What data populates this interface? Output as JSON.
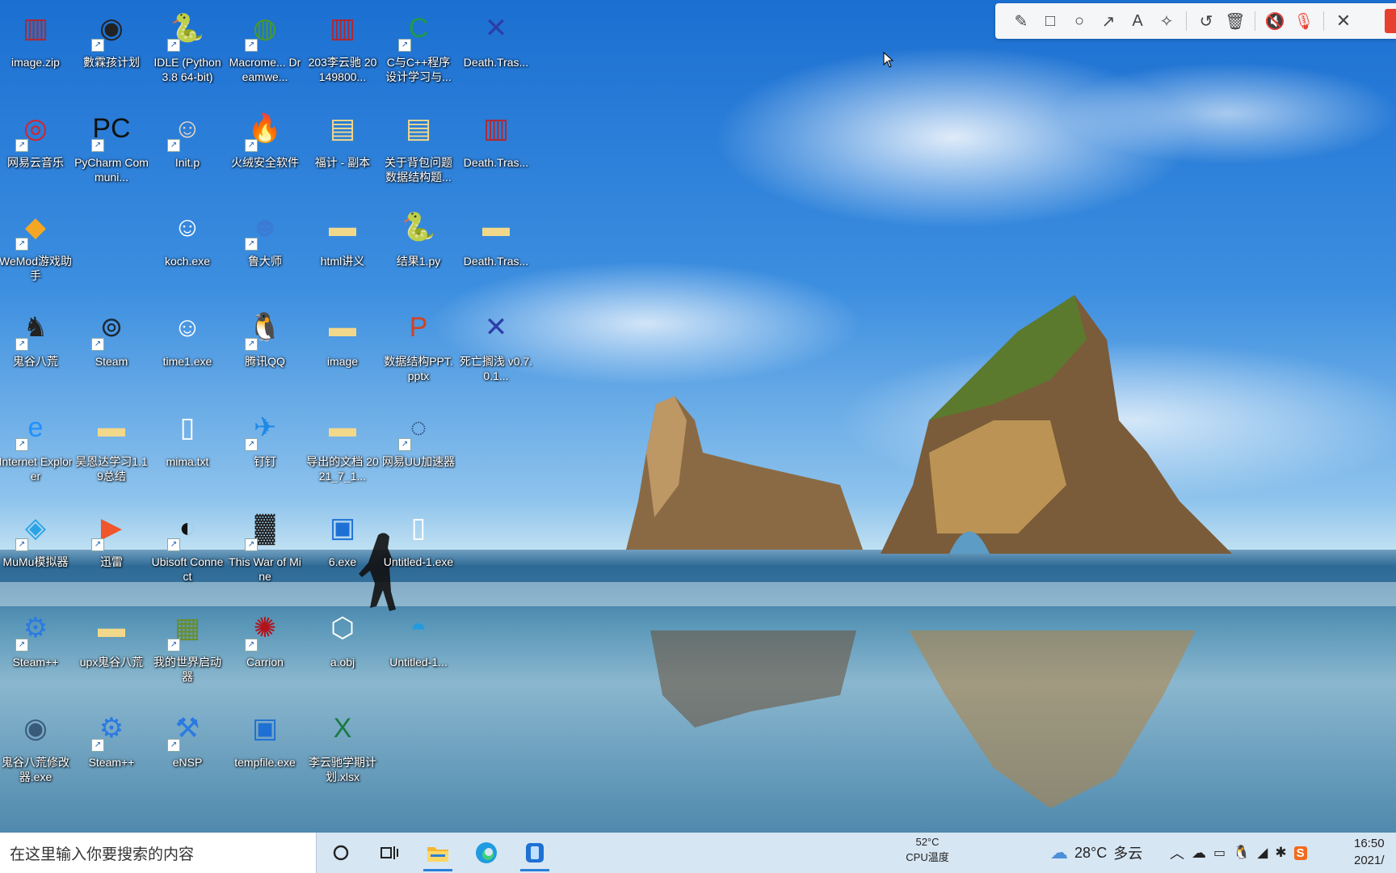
{
  "desktop": {
    "icons": [
      {
        "label": "image.zip",
        "icon": "winrar-archive-icon",
        "glyph": "▥",
        "color": "#b3262d",
        "shortcut": false
      },
      {
        "label": "數霖孩计划",
        "icon": "app-shortcut-icon",
        "glyph": "◉",
        "color": "#222222",
        "shortcut": true
      },
      {
        "label": "IDLE (Python 3.8 64-bit)",
        "icon": "python-idle-icon",
        "glyph": "🐍",
        "color": "#ffffff",
        "shortcut": true
      },
      {
        "label": "Macrome... Dreamwe...",
        "icon": "dreamweaver-icon",
        "glyph": "◍",
        "color": "#4a9a26",
        "shortcut": true
      },
      {
        "label": "203李云驰 20149800...",
        "icon": "winrar-archive-icon",
        "glyph": "▥",
        "color": "#b3262d",
        "shortcut": false
      },
      {
        "label": "C与C++程序设计学习与...",
        "icon": "c-language-icon",
        "glyph": "C",
        "color": "#1f9a4a",
        "shortcut": true
      },
      {
        "label": "Death.Tras...",
        "icon": "game-shortcut-icon",
        "glyph": "✕",
        "color": "#2d3ea8",
        "shortcut": false
      },
      {
        "label": "网易云音乐",
        "icon": "netease-music-icon",
        "glyph": "◎",
        "color": "#d8232a",
        "shortcut": true
      },
      {
        "label": "PyCharm Communi...",
        "icon": "pycharm-icon",
        "glyph": "PC",
        "color": "#111111",
        "shortcut": true
      },
      {
        "label": "Init.p",
        "icon": "anime-app-icon",
        "glyph": "☺",
        "color": "#e8d7c8",
        "shortcut": true
      },
      {
        "label": "火绒安全软件",
        "icon": "huorong-security-icon",
        "glyph": "🔥",
        "color": "#f28c1b",
        "shortcut": true
      },
      {
        "label": "福计 - 副本",
        "icon": "document-icon",
        "glyph": "▤",
        "color": "#f2d88a",
        "shortcut": false
      },
      {
        "label": "关于背包问题数据结构题...",
        "icon": "document-icon",
        "glyph": "▤",
        "color": "#f2d88a",
        "shortcut": false
      },
      {
        "label": "Death.Tras...",
        "icon": "winrar-archive-icon",
        "glyph": "▥",
        "color": "#b3262d",
        "shortcut": false
      },
      {
        "label": "WeMod游戏助手",
        "icon": "wemod-icon",
        "glyph": "◆",
        "color": "#f5a623",
        "shortcut": true
      },
      {
        "label": "",
        "icon": "empty-slot",
        "glyph": "",
        "color": "#000000",
        "shortcut": false
      },
      {
        "label": "koch.exe",
        "icon": "smiley-exe-icon",
        "glyph": "☺",
        "color": "#ffffff",
        "shortcut": false
      },
      {
        "label": "鲁大师",
        "icon": "ludashi-icon",
        "glyph": "☻",
        "color": "#3a7bd5",
        "shortcut": true
      },
      {
        "label": "html讲义",
        "icon": "folder-icon",
        "glyph": "▬",
        "color": "#f2d88a",
        "shortcut": false
      },
      {
        "label": "结果1.py",
        "icon": "python-file-icon",
        "glyph": "🐍",
        "color": "#ffffff",
        "shortcut": false
      },
      {
        "label": "Death.Tras...",
        "icon": "folder-icon",
        "glyph": "▬",
        "color": "#f2d88a",
        "shortcut": false
      },
      {
        "label": "鬼谷八荒",
        "icon": "game-dragon-icon",
        "glyph": "♞",
        "color": "#222222",
        "shortcut": true
      },
      {
        "label": "Steam",
        "icon": "steam-icon",
        "glyph": "⊚",
        "color": "#1b2838",
        "shortcut": true
      },
      {
        "label": "time1.exe",
        "icon": "smiley-exe-icon",
        "glyph": "☺",
        "color": "#ffffff",
        "shortcut": false
      },
      {
        "label": "腾讯QQ",
        "icon": "qq-penguin-icon",
        "glyph": "🐧",
        "color": "#111111",
        "shortcut": true
      },
      {
        "label": "image",
        "icon": "folder-icon",
        "glyph": "▬",
        "color": "#f2d88a",
        "shortcut": false
      },
      {
        "label": "数据结构PPT.pptx",
        "icon": "powerpoint-file-icon",
        "glyph": "P",
        "color": "#d04423",
        "shortcut": false
      },
      {
        "label": "死亡搁浅 v0.7.0.1...",
        "icon": "game-shortcut-icon",
        "glyph": "✕",
        "color": "#2d3ea8",
        "shortcut": false
      },
      {
        "label": "Internet Explorer",
        "icon": "internet-explorer-icon",
        "glyph": "e",
        "color": "#1e90ff",
        "shortcut": true
      },
      {
        "label": "吴恩达学习1.19总结",
        "icon": "folder-icon",
        "glyph": "▬",
        "color": "#f2d88a",
        "shortcut": false
      },
      {
        "label": "mima.txt",
        "icon": "text-file-icon",
        "glyph": "▯",
        "color": "#ffffff",
        "shortcut": false
      },
      {
        "label": "钉钉",
        "icon": "dingtalk-icon",
        "glyph": "✈",
        "color": "#1e88e5",
        "shortcut": true
      },
      {
        "label": "导出的文档 2021_7_1...",
        "icon": "folder-icon",
        "glyph": "▬",
        "color": "#f2d88a",
        "shortcut": false
      },
      {
        "label": "网易UU加速器",
        "icon": "uu-accelerator-icon",
        "glyph": "◌",
        "color": "#183d6b",
        "shortcut": true
      },
      {
        "label": "",
        "icon": "empty-slot",
        "glyph": "",
        "color": "#000000",
        "shortcut": false
      },
      {
        "label": "MuMu模拟器",
        "icon": "mumu-emulator-icon",
        "glyph": "◈",
        "color": "#29a3e6",
        "shortcut": true
      },
      {
        "label": "迅雷",
        "icon": "video-app-icon",
        "glyph": "▶",
        "color": "#f0552b",
        "shortcut": true
      },
      {
        "label": "Ubisoft Connect",
        "icon": "ubisoft-icon",
        "glyph": "◐",
        "color": "#111111",
        "shortcut": true
      },
      {
        "label": "This War of Mine",
        "icon": "this-war-of-mine-icon",
        "glyph": "▓",
        "color": "#1b1b1b",
        "shortcut": true
      },
      {
        "label": "6.exe",
        "icon": "exe-window-icon",
        "glyph": "▣",
        "color": "#1e70d4",
        "shortcut": false
      },
      {
        "label": "Untitled-1.exe",
        "icon": "blank-file-icon",
        "glyph": "▯",
        "color": "#ffffff",
        "shortcut": false
      },
      {
        "label": "",
        "icon": "empty-slot",
        "glyph": "",
        "color": "#000000",
        "shortcut": false
      },
      {
        "label": "Steam++",
        "icon": "steam-plus-icon",
        "glyph": "⚙",
        "color": "#2a7ae2",
        "shortcut": true
      },
      {
        "label": "upx鬼谷八荒",
        "icon": "folder-icon",
        "glyph": "▬",
        "color": "#f2d88a",
        "shortcut": false
      },
      {
        "label": "我的世界启动器",
        "icon": "minecraft-icon",
        "glyph": "▦",
        "color": "#6b8e23",
        "shortcut": true
      },
      {
        "label": "Carrion",
        "icon": "carrion-game-icon",
        "glyph": "✺",
        "color": "#b3131b",
        "shortcut": true
      },
      {
        "label": "a.obj",
        "icon": "3d-object-icon",
        "glyph": "⬡",
        "color": "#ffffff",
        "shortcut": false
      },
      {
        "label": "Untitled-1...",
        "icon": "edge-browser-icon",
        "glyph": "◓",
        "color": "#1f9be0",
        "shortcut": false
      },
      {
        "label": "",
        "icon": "empty-slot",
        "glyph": "",
        "color": "#000000",
        "shortcut": false
      },
      {
        "label": "鬼谷八荒修改器.exe",
        "icon": "trainer-icon",
        "glyph": "◉",
        "color": "#3a5a7a",
        "shortcut": false
      },
      {
        "label": "Steam++",
        "icon": "steam-plus-icon",
        "glyph": "⚙",
        "color": "#2a7ae2",
        "shortcut": true
      },
      {
        "label": "eNSP",
        "icon": "ensp-icon",
        "glyph": "⚒",
        "color": "#2a7ae2",
        "shortcut": true
      },
      {
        "label": "tempfile.exe",
        "icon": "exe-window-icon",
        "glyph": "▣",
        "color": "#1e70d4",
        "shortcut": false
      },
      {
        "label": "李云驰学期计划.xlsx",
        "icon": "excel-file-icon",
        "glyph": "X",
        "color": "#1d7a43",
        "shortcut": false
      },
      {
        "label": "",
        "icon": "empty-slot",
        "glyph": "",
        "color": "#000000",
        "shortcut": false
      },
      {
        "label": "",
        "icon": "empty-slot",
        "glyph": "",
        "color": "#000000",
        "shortcut": false
      }
    ]
  },
  "toolbar": {
    "tools": [
      {
        "name": "pen-icon",
        "glyph": "✎"
      },
      {
        "name": "rectangle-icon",
        "glyph": "□"
      },
      {
        "name": "circle-icon",
        "glyph": "○"
      },
      {
        "name": "arrow-icon",
        "glyph": "↗"
      },
      {
        "name": "text-icon",
        "glyph": "A"
      },
      {
        "name": "magic-wand-icon",
        "glyph": "✧"
      }
    ],
    "actions": [
      {
        "name": "undo-icon",
        "glyph": "↺"
      },
      {
        "name": "delete-icon",
        "glyph": "🗑"
      }
    ],
    "media": [
      {
        "name": "speaker-muted-icon",
        "glyph": "🔇"
      },
      {
        "name": "microphone-muted-icon",
        "glyph": "🎙"
      }
    ],
    "close_glyph": "✕",
    "accent_color": "#e8402f"
  },
  "taskbar": {
    "search_placeholder": "在这里输入你要搜索的内容",
    "cpu_temp": "52°C",
    "cpu_label": "CPU温度",
    "weather_temp": "28°C",
    "weather_text": "多云",
    "clock_time": "16:50",
    "clock_date": "2021/"
  }
}
